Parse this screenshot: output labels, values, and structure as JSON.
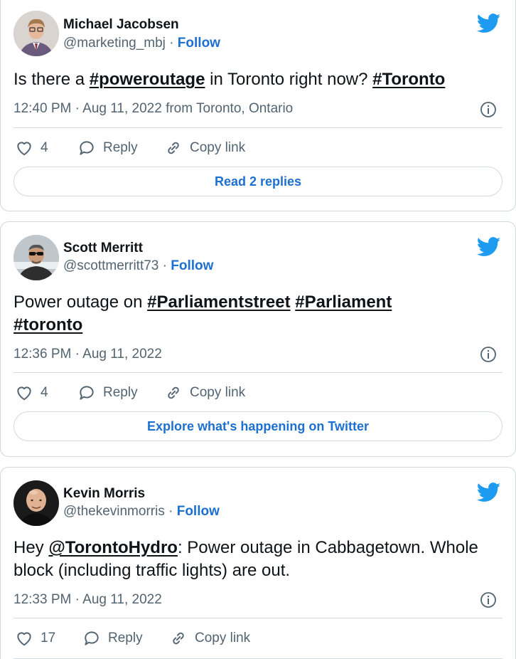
{
  "colors": {
    "link_blue": "#1d6fd0",
    "text_dark": "#0f1419",
    "text_gray": "#536471",
    "twitter_blue": "#1d9bf0",
    "border": "#cfd9de"
  },
  "tweets": [
    {
      "name": "Michael Jacobsen",
      "handle": "@marketing_mbj",
      "separator": "·",
      "follow_label": "Follow",
      "text_parts": [
        {
          "t": "Is there a ",
          "kind": "text"
        },
        {
          "t": "#poweroutage",
          "kind": "hashtag"
        },
        {
          "t": " in Toronto right now? ",
          "kind": "text"
        },
        {
          "t": "#Toronto",
          "kind": "hashtag"
        }
      ],
      "timestamp": "12:40 PM · Aug 11, 2022 from Toronto, Ontario",
      "likes": "4",
      "reply_label": "Reply",
      "copy_label": "Copy link",
      "button_label": "Read 2 replies",
      "avatar_icon": "avatar-suit-man"
    },
    {
      "name": "Scott Merritt",
      "handle": "@scottmerritt73",
      "separator": "·",
      "follow_label": "Follow",
      "text_parts": [
        {
          "t": "Power outage on ",
          "kind": "text"
        },
        {
          "t": "#Parliamentstreet",
          "kind": "hashtag"
        },
        {
          "t": " ",
          "kind": "text"
        },
        {
          "t": "#Parliament",
          "kind": "hashtag"
        },
        {
          "t": " ",
          "kind": "text"
        },
        {
          "t": "#toronto",
          "kind": "hashtag"
        }
      ],
      "timestamp": "12:36 PM · Aug 11, 2022",
      "likes": "4",
      "reply_label": "Reply",
      "copy_label": "Copy link",
      "button_label": "Explore what's happening on Twitter",
      "avatar_icon": "avatar-sunglasses-man"
    },
    {
      "name": "Kevin Morris",
      "handle": "@thekevinmorris",
      "separator": "·",
      "follow_label": "Follow",
      "text_parts": [
        {
          "t": "Hey ",
          "kind": "text"
        },
        {
          "t": "@TorontoHydro",
          "kind": "mention"
        },
        {
          "t": ": Power outage in Cabbagetown. Whole block (including traffic lights) are out.",
          "kind": "text"
        }
      ],
      "timestamp": "12:33 PM · Aug 11, 2022",
      "likes": "17",
      "reply_label": "Reply",
      "copy_label": "Copy link",
      "avatar_icon": "avatar-bald-man"
    }
  ]
}
